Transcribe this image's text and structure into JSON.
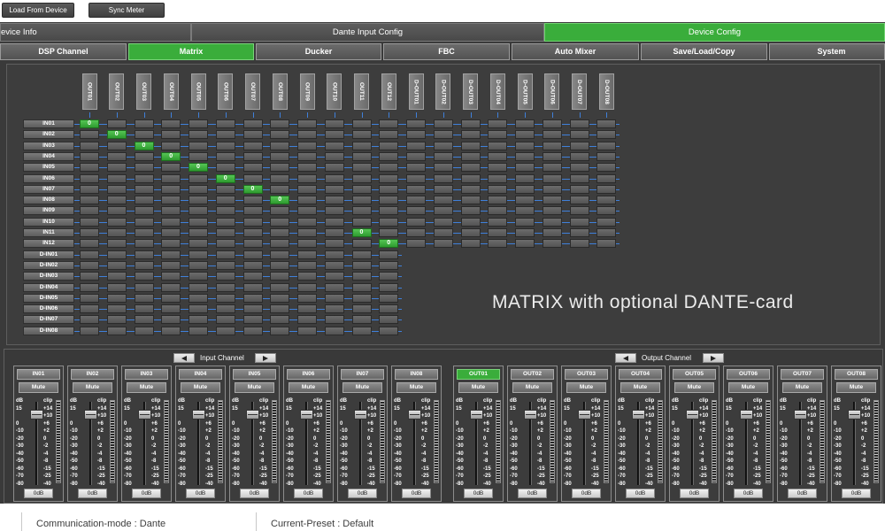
{
  "theme": {
    "active_green": "#3aad3b",
    "route_line_blue": "#3f80da"
  },
  "toolbar": {
    "load_from_device": "Load From Device",
    "sync_meter": "Sync Meter"
  },
  "top_tabs": [
    {
      "label": "evice Info",
      "active": false
    },
    {
      "label": "Dante Input Config",
      "active": false
    },
    {
      "label": "Device Config",
      "active": true
    }
  ],
  "sub_tabs": [
    {
      "label": "DSP Channel",
      "active": false
    },
    {
      "label": "Matrix",
      "active": true
    },
    {
      "label": "Ducker",
      "active": false
    },
    {
      "label": "FBC",
      "active": false
    },
    {
      "label": "Auto Mixer",
      "active": false
    },
    {
      "label": "Save/Load/Copy",
      "active": false
    },
    {
      "label": "System",
      "active": false
    }
  ],
  "matrix": {
    "outputs": [
      "OUT01",
      "OUT02",
      "OUT03",
      "OUT04",
      "OUT05",
      "OUT06",
      "OUT07",
      "OUT08",
      "OUT09",
      "OUT10",
      "OUT11",
      "OUT12",
      "D-OUT01",
      "D-OUT02",
      "D-OUT03",
      "D-OUT04",
      "D-OUT05",
      "D-OUT06",
      "D-OUT07",
      "D-OUT08"
    ],
    "inputs": [
      "IN01",
      "IN02",
      "IN03",
      "IN04",
      "IN05",
      "IN06",
      "IN07",
      "IN08",
      "IN09",
      "IN10",
      "IN11",
      "IN12",
      "D-IN01",
      "D-IN02",
      "D-IN03",
      "D-IN04",
      "D-IN05",
      "D-IN06",
      "D-IN07",
      "D-IN08"
    ],
    "routes": {
      "IN01": {
        "OUT01": "0"
      },
      "IN02": {
        "OUT02": "0"
      },
      "IN03": {
        "OUT03": "0"
      },
      "IN04": {
        "OUT04": "0"
      },
      "IN05": {
        "OUT05": "0"
      },
      "IN06": {
        "OUT06": "0"
      },
      "IN07": {
        "OUT07": "0"
      },
      "IN08": {
        "OUT08": "0"
      },
      "IN11": {
        "OUT11": "0"
      },
      "IN12": {
        "OUT12": "0"
      }
    },
    "caption": "MATRIX with optional DANTE-card"
  },
  "input_section": {
    "label": "Input Channel",
    "prev_icon": "triangle-left-icon",
    "next_icon": "triangle-right-icon",
    "channels": [
      {
        "name": "IN01",
        "mute": "Mute",
        "gain": "0dB",
        "selected": false
      },
      {
        "name": "IN02",
        "mute": "Mute",
        "gain": "0dB",
        "selected": false
      },
      {
        "name": "IN03",
        "mute": "Mute",
        "gain": "0dB",
        "selected": false
      },
      {
        "name": "IN04",
        "mute": "Mute",
        "gain": "0dB",
        "selected": false
      },
      {
        "name": "IN05",
        "mute": "Mute",
        "gain": "0dB",
        "selected": false
      },
      {
        "name": "IN06",
        "mute": "Mute",
        "gain": "0dB",
        "selected": false
      },
      {
        "name": "IN07",
        "mute": "Mute",
        "gain": "0dB",
        "selected": false
      },
      {
        "name": "IN08",
        "mute": "Mute",
        "gain": "0dB",
        "selected": false
      }
    ]
  },
  "output_section": {
    "label": "Output Channel",
    "prev_icon": "triangle-left-icon",
    "next_icon": "triangle-right-icon",
    "channels": [
      {
        "name": "OUT01",
        "mute": "Mute",
        "gain": "0dB",
        "selected": true
      },
      {
        "name": "OUT02",
        "mute": "Mute",
        "gain": "0dB",
        "selected": false
      },
      {
        "name": "OUT03",
        "mute": "Mute",
        "gain": "0dB",
        "selected": false
      },
      {
        "name": "OUT04",
        "mute": "Mute",
        "gain": "0dB",
        "selected": false
      },
      {
        "name": "OUT05",
        "mute": "Mute",
        "gain": "0dB",
        "selected": false
      },
      {
        "name": "OUT06",
        "mute": "Mute",
        "gain": "0dB",
        "selected": false
      },
      {
        "name": "OUT07",
        "mute": "Mute",
        "gain": "0dB",
        "selected": false
      },
      {
        "name": "OUT08",
        "mute": "Mute",
        "gain": "0dB",
        "selected": false
      }
    ]
  },
  "fader_scale": {
    "left": [
      "dB",
      "15",
      "0",
      "-10",
      "-20",
      "-30",
      "-40",
      "-50",
      "-60",
      "-70",
      "-80"
    ],
    "right": [
      "clip",
      "+14",
      "+10",
      "+6",
      "+2",
      "0",
      "-2",
      "-4",
      "-8",
      "-15",
      "-25",
      "-40"
    ]
  },
  "status_bar": {
    "communication_mode": "Communication-mode : Dante",
    "current_preset": "Current-Preset : Default"
  }
}
